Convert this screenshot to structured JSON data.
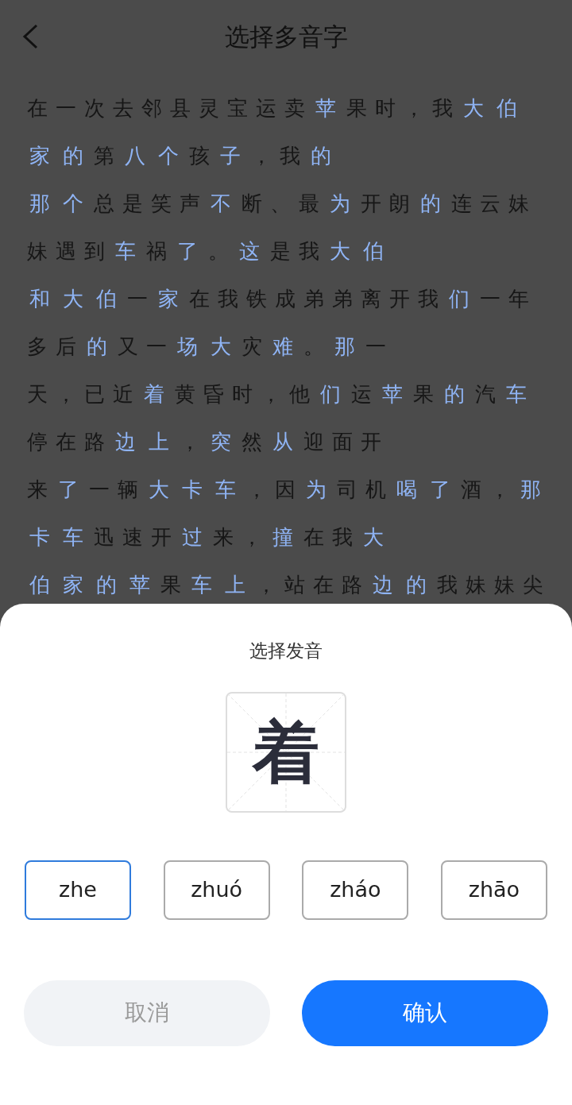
{
  "header": {
    "title": "选择多音字"
  },
  "passage": {
    "lines": [
      [
        {
          "text": "在一次去邻县灵宝运卖",
          "highlighted": false
        },
        {
          "text": "苹",
          "highlighted": true
        },
        {
          "text": "果时，我",
          "highlighted": false
        },
        {
          "text": "大",
          "highlighted": true
        },
        {
          "text": "伯",
          "highlighted": true
        }
      ],
      [
        {
          "text": "家",
          "highlighted": true
        },
        {
          "text": "的",
          "highlighted": true
        },
        {
          "text": "第",
          "highlighted": false
        },
        {
          "text": "八",
          "highlighted": true
        },
        {
          "text": "个",
          "highlighted": true
        },
        {
          "text": "孩",
          "highlighted": false
        },
        {
          "text": "子",
          "highlighted": true
        },
        {
          "text": "，我",
          "highlighted": false
        },
        {
          "text": "的",
          "highlighted": true
        }
      ],
      [
        {
          "text": "那",
          "highlighted": true
        },
        {
          "text": "个",
          "highlighted": true
        },
        {
          "text": "总是笑声",
          "highlighted": false
        },
        {
          "text": "不",
          "highlighted": true
        },
        {
          "text": "断、最",
          "highlighted": false
        },
        {
          "text": "为",
          "highlighted": true
        },
        {
          "text": "开朗",
          "highlighted": false
        },
        {
          "text": "的",
          "highlighted": true
        },
        {
          "text": "连云妹",
          "highlighted": false
        }
      ],
      [
        {
          "text": "妹遇到",
          "highlighted": false
        },
        {
          "text": "车",
          "highlighted": true
        },
        {
          "text": "祸",
          "highlighted": false
        },
        {
          "text": "了",
          "highlighted": true
        },
        {
          "text": "。",
          "highlighted": false
        },
        {
          "text": "这",
          "highlighted": true
        },
        {
          "text": "是我",
          "highlighted": false
        },
        {
          "text": "大",
          "highlighted": true
        },
        {
          "text": "伯",
          "highlighted": true
        }
      ],
      [
        {
          "text": "和",
          "highlighted": true
        },
        {
          "text": "大",
          "highlighted": true
        },
        {
          "text": "伯",
          "highlighted": true
        },
        {
          "text": "一",
          "highlighted": false
        },
        {
          "text": "家",
          "highlighted": true
        },
        {
          "text": "在我铁成弟弟离开我",
          "highlighted": false
        },
        {
          "text": "们",
          "highlighted": true
        },
        {
          "text": "一年",
          "highlighted": false
        }
      ],
      [
        {
          "text": "多后",
          "highlighted": false
        },
        {
          "text": "的",
          "highlighted": true
        },
        {
          "text": "又一",
          "highlighted": false
        },
        {
          "text": "场",
          "highlighted": true
        },
        {
          "text": "大",
          "highlighted": true
        },
        {
          "text": "灾",
          "highlighted": false
        },
        {
          "text": "难",
          "highlighted": true
        },
        {
          "text": "。",
          "highlighted": false
        },
        {
          "text": "那",
          "highlighted": true
        },
        {
          "text": "一",
          "highlighted": false
        }
      ],
      [
        {
          "text": "天，已近",
          "highlighted": false
        },
        {
          "text": "着",
          "highlighted": true
        },
        {
          "text": "黄昏时，他",
          "highlighted": false
        },
        {
          "text": "们",
          "highlighted": true
        },
        {
          "text": "运",
          "highlighted": false
        },
        {
          "text": "苹",
          "highlighted": true
        },
        {
          "text": "果",
          "highlighted": false
        },
        {
          "text": "的",
          "highlighted": true
        },
        {
          "text": "汽",
          "highlighted": false
        },
        {
          "text": "车",
          "highlighted": true
        }
      ],
      [
        {
          "text": "停在路",
          "highlighted": false
        },
        {
          "text": "边",
          "highlighted": true
        },
        {
          "text": "上",
          "highlighted": true
        },
        {
          "text": "，",
          "highlighted": false
        },
        {
          "text": "突",
          "highlighted": true
        },
        {
          "text": "然",
          "highlighted": false
        },
        {
          "text": "从",
          "highlighted": true
        },
        {
          "text": "迎面开",
          "highlighted": false
        }
      ],
      [
        {
          "text": "来",
          "highlighted": false
        },
        {
          "text": "了",
          "highlighted": true
        },
        {
          "text": "一辆",
          "highlighted": false
        },
        {
          "text": "大",
          "highlighted": true
        },
        {
          "text": "卡",
          "highlighted": true
        },
        {
          "text": "车",
          "highlighted": true
        },
        {
          "text": "，因",
          "highlighted": false
        },
        {
          "text": "为",
          "highlighted": true
        },
        {
          "text": "司机",
          "highlighted": false
        },
        {
          "text": "喝",
          "highlighted": true
        },
        {
          "text": "了",
          "highlighted": true
        },
        {
          "text": "酒，",
          "highlighted": false
        },
        {
          "text": "那",
          "highlighted": true
        }
      ],
      [
        {
          "text": "卡",
          "highlighted": true
        },
        {
          "text": "车",
          "highlighted": true
        },
        {
          "text": "迅速开",
          "highlighted": false
        },
        {
          "text": "过",
          "highlighted": true
        },
        {
          "text": "来，",
          "highlighted": false
        },
        {
          "text": "撞",
          "highlighted": true
        },
        {
          "text": "在我",
          "highlighted": false
        },
        {
          "text": "大",
          "highlighted": true
        }
      ],
      [
        {
          "text": "伯",
          "highlighted": true
        },
        {
          "text": "家",
          "highlighted": true
        },
        {
          "text": "的",
          "highlighted": true
        },
        {
          "text": "苹",
          "highlighted": true
        },
        {
          "text": "果",
          "highlighted": false
        },
        {
          "text": "车",
          "highlighted": true
        },
        {
          "text": "上",
          "highlighted": true
        },
        {
          "text": "，站在路",
          "highlighted": false
        },
        {
          "text": "边",
          "highlighted": true
        },
        {
          "text": "的",
          "highlighted": true
        },
        {
          "text": "我妹妹尖",
          "highlighted": false
        }
      ]
    ]
  },
  "sheet": {
    "title": "选择发音",
    "character": "着",
    "options": [
      {
        "label": "zhe",
        "selected": true
      },
      {
        "label": "zhuó",
        "selected": false
      },
      {
        "label": "zháo",
        "selected": false
      },
      {
        "label": "zhāo",
        "selected": false
      }
    ],
    "cancel": "取消",
    "confirm": "确认"
  }
}
